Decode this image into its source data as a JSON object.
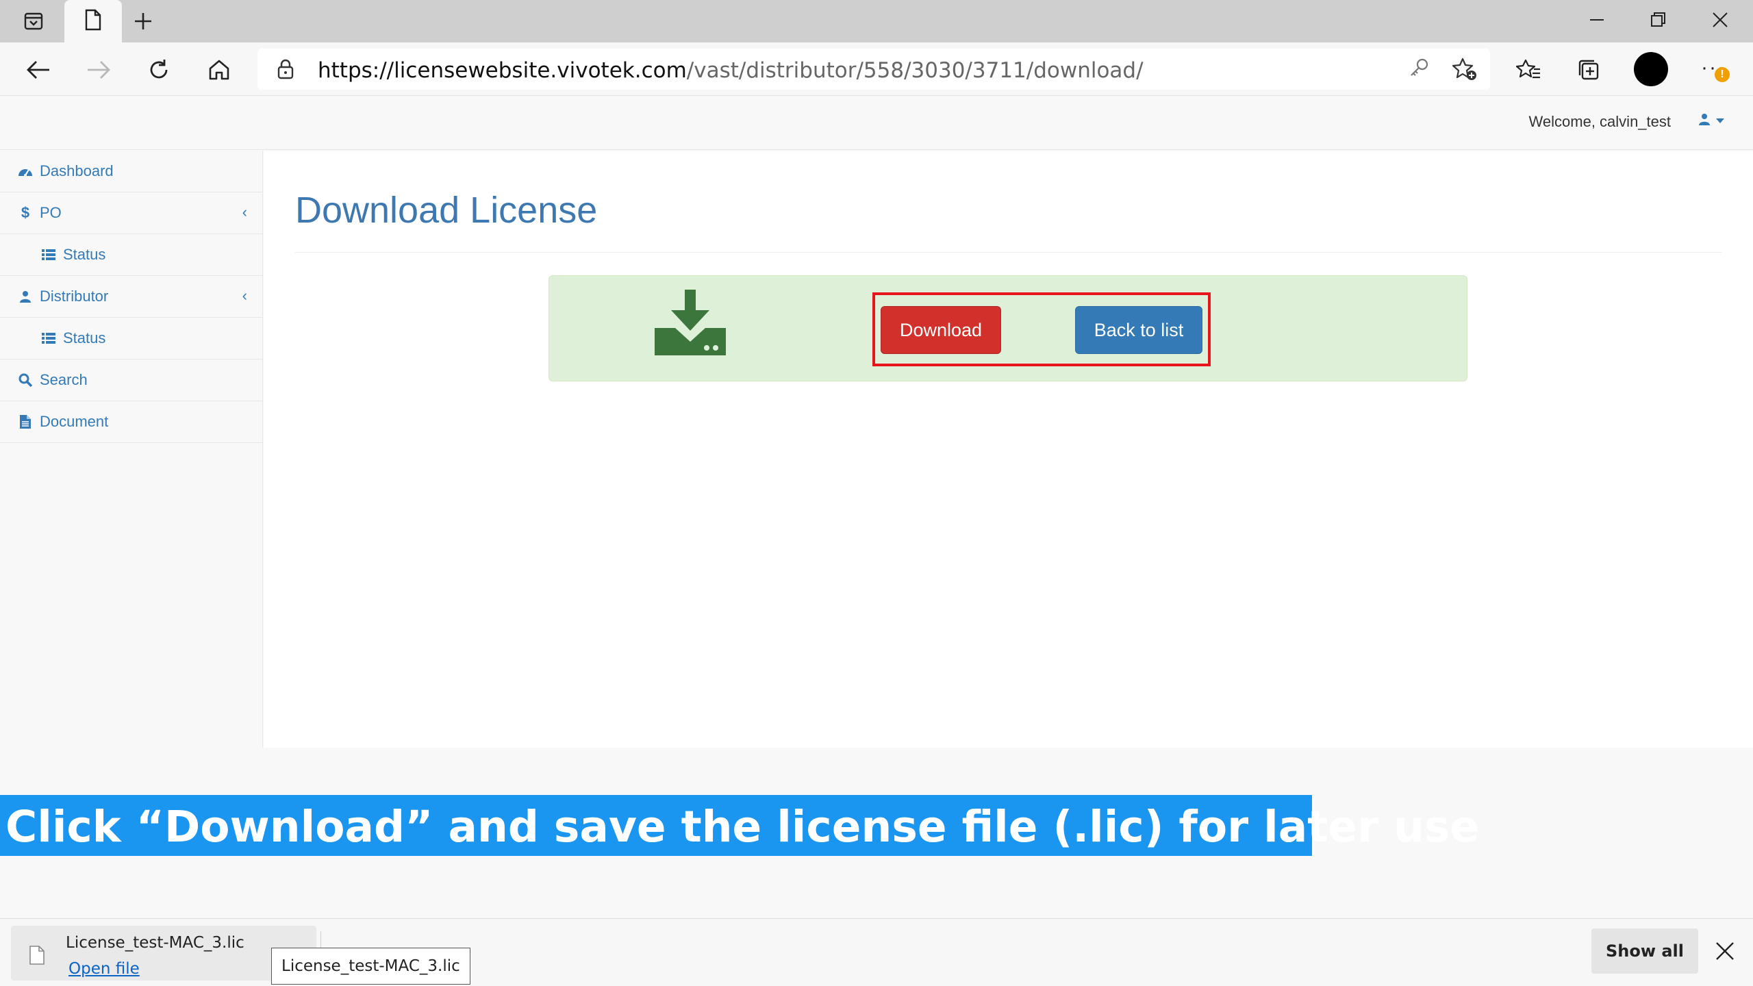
{
  "browser": {
    "url_host": "https://licensewebsite.vivotek.com",
    "url_path": "/vast/distributor/558/3030/3711/download/",
    "icons": {
      "tab_actions": "tab-actions-icon",
      "tab": "page-icon",
      "new_tab": "plus-icon",
      "back": "back-arrow-icon",
      "forward": "forward-arrow-icon",
      "refresh": "refresh-icon",
      "home": "home-icon",
      "lock": "lock-icon",
      "key": "key-icon",
      "add_favorite": "add-favorite-icon",
      "favorites": "favorites-icon",
      "collections": "collections-icon",
      "more": "more-icon"
    },
    "more_badge": "!"
  },
  "topnav": {
    "welcome": "Welcome, calvin_test"
  },
  "sidebar": {
    "items": [
      {
        "label": "Dashboard",
        "icon": "dashboard-icon"
      },
      {
        "label": "PO",
        "icon": "dollar-icon",
        "arrow": "‹"
      },
      {
        "label": "Status",
        "icon": "list-icon"
      },
      {
        "label": "Distributor",
        "icon": "user-icon",
        "arrow": "‹"
      },
      {
        "label": "Status",
        "icon": "list-icon"
      },
      {
        "label": "Search",
        "icon": "search-icon"
      },
      {
        "label": "Document",
        "icon": "file-icon"
      }
    ]
  },
  "main": {
    "title": "Download License",
    "download_label": "Download",
    "back_label": "Back to list"
  },
  "caption": {
    "text": "Click “Download” and save the license file (.lic) for later use"
  },
  "download_shelf": {
    "file_name": "License_test-MAC_3.lic",
    "open_label": "Open file",
    "tooltip": "License_test-MAC_3.lic",
    "show_all_label": "Show all"
  },
  "colors": {
    "link_blue": "#337ab7",
    "title_blue": "#3e78b0",
    "success_bg": "#dff0d8",
    "success_icon": "#3c763d",
    "danger": "#d2302b",
    "highlight_red": "#e8141b",
    "caption_bg": "#1a96f0"
  }
}
